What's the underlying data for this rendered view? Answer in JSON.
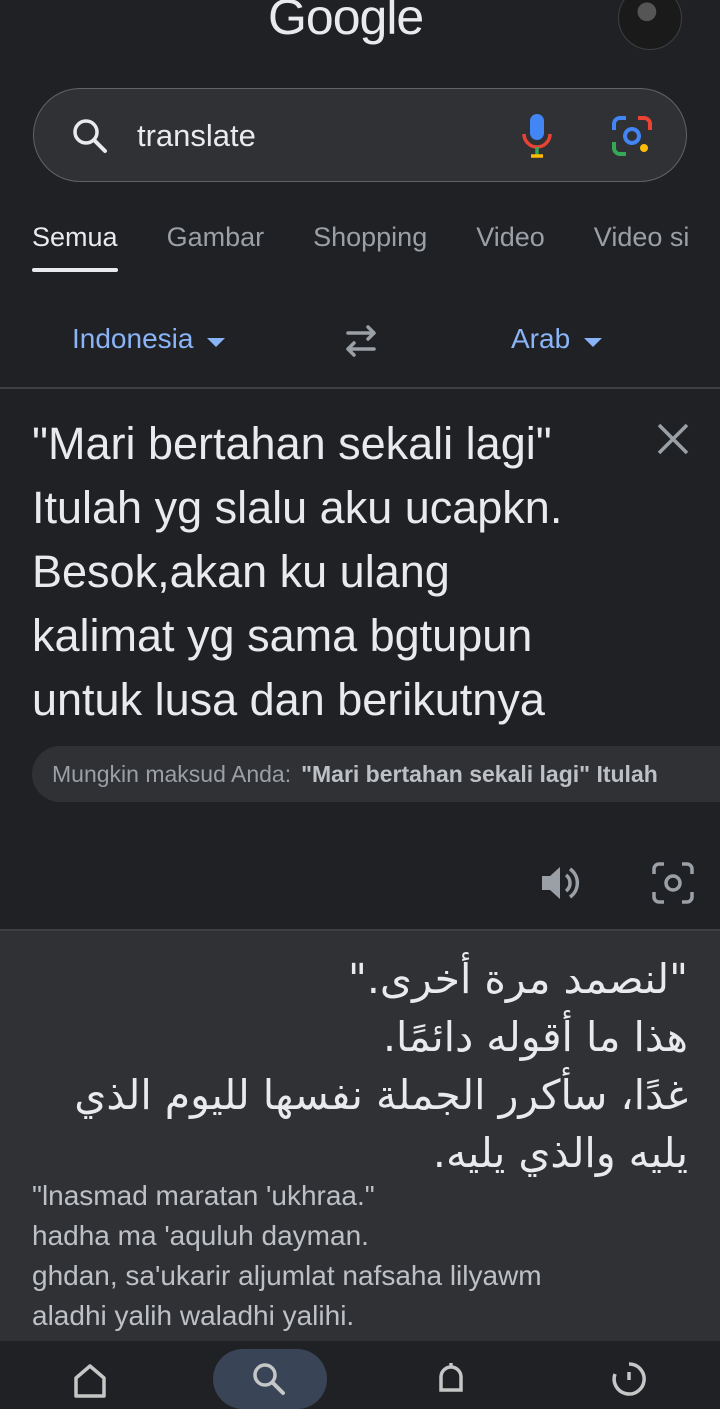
{
  "header": {
    "logo": "Google"
  },
  "search": {
    "query": "translate",
    "icons": [
      "search-icon",
      "mic-icon",
      "lens-icon"
    ]
  },
  "tabs": [
    {
      "label": "Semua",
      "active": true
    },
    {
      "label": "Gambar"
    },
    {
      "label": "Shopping"
    },
    {
      "label": "Video"
    },
    {
      "label": "Video si"
    }
  ],
  "translate": {
    "source_lang": "Indonesia",
    "target_lang": "Arab",
    "source_text": "\"Mari bertahan sekali lagi\"\nItulah yg slalu aku ucapkn.\nBesok,akan ku ulang\nkalimat yg sama bgtupun\nuntuk lusa dan berikutnya",
    "suggestion_label": "Mungkin maksud Anda:",
    "suggestion_value": "\"Mari bertahan sekali lagi\" Itulah",
    "result_arabic": "\"لنصمد مرة أخرى.\"\nهذا ما أقوله دائمًا.\nغدًا، سأكرر الجملة نفسها لليوم الذي\nيليه والذي يليه.",
    "result_translit": "\"lnasmad maratan 'ukhraa.\"\nhadha ma 'aquluh dayman.\nghdan, sa'ukarir aljumlat nafsaha lilyawm\naladhi yalih waladhi yalihi."
  },
  "colors": {
    "background": "#202124",
    "surface": "#303134",
    "link": "#8ab4f8"
  },
  "bottom_nav": [
    "home-icon",
    "search-icon",
    "notifications-icon",
    "history-icon"
  ]
}
